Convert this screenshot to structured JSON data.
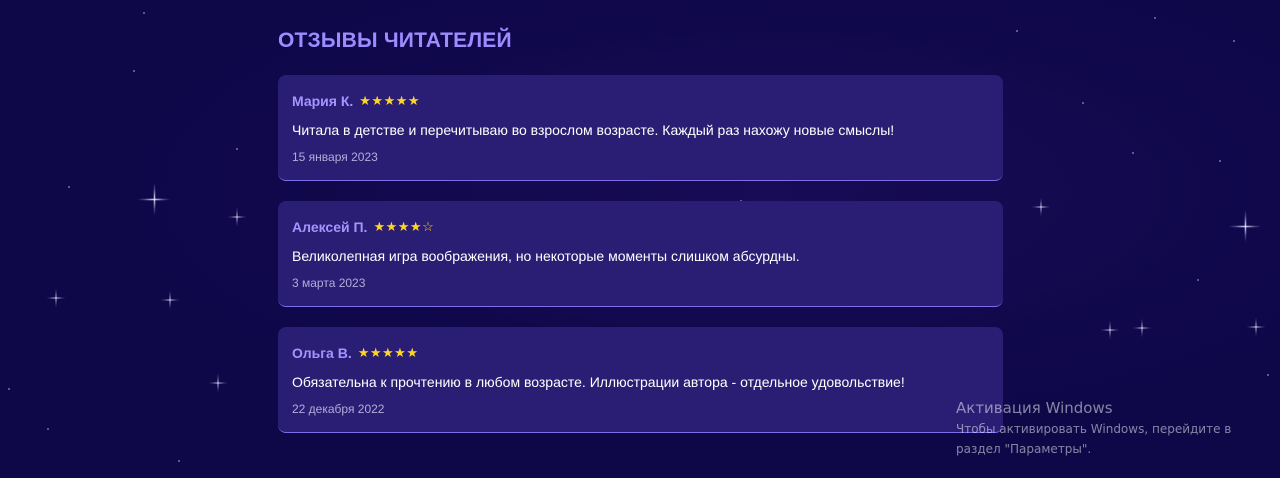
{
  "section": {
    "title": "ОТЗЫВЫ ЧИТАТЕЛЕЙ"
  },
  "reviews": [
    {
      "name": "Мария К.",
      "stars": "★★★★★",
      "rating": 5,
      "text": "Читала в детстве и перечитываю во взрослом возрасте. Каждый раз нахожу новые смыслы!",
      "date": "15 января 2023"
    },
    {
      "name": "Алексей П.",
      "stars": "★★★★☆",
      "rating": 4,
      "text": "Великолепная игра воображения, но некоторые моменты слишком абсурдны.",
      "date": "3 марта 2023"
    },
    {
      "name": "Ольга В.",
      "stars": "★★★★★",
      "rating": 5,
      "text": "Обязательна к прочтению в любом возрасте. Иллюстрации автора - отдельное удовольствие!",
      "date": "22 декабря 2022"
    }
  ],
  "watermark": {
    "title": "Активация Windows",
    "line1": "Чтобы активировать Windows, перейдите в",
    "line2": "раздел \"Параметры\"."
  },
  "colors": {
    "background": "#0e0748",
    "card": "#2a1d74",
    "accent": "#9d8cff",
    "star": "#ffd42a"
  }
}
